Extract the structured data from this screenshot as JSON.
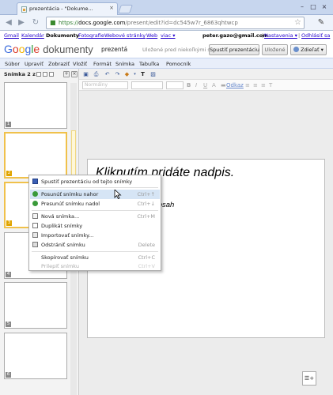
{
  "browser": {
    "tab_title": "prezentácia - \"Dokume...",
    "tab_close": "×",
    "url_scheme": "https://",
    "url_host": "docs.google.com",
    "url_path": "/present/edit?id=dc545w7r_6863qhtwcp"
  },
  "gbar": {
    "links": [
      "Gmail",
      "Kalendár",
      "Dokumenty",
      "Fotografie",
      "Webové stránky",
      "Web",
      "viac ▾"
    ],
    "current": "Dokumenty",
    "user": "peter.gazo@gmail.com",
    "settings": "Nastavenia ▾",
    "signout": "Odhlásiť sa"
  },
  "header": {
    "logo_google": "Google",
    "logo_product": "dokumenty",
    "doc_title": "prezentá",
    "save_status": "Uložené pred niekoľkými sekundami",
    "start_btn": "Spustiť prezentáciu",
    "saved_btn": "Uložené",
    "share_btn": "Zdieľať ▾"
  },
  "menu": [
    "Súbor",
    "Upraviť",
    "Zobraziť",
    "Vložiť",
    "Formát",
    "Snímka",
    "Tabuľka",
    "Pomocník"
  ],
  "leftpanel": {
    "slide_count": "Snímka 2 z 7",
    "thumb_numbers": [
      "1",
      "2",
      "3",
      "4",
      "5",
      "6"
    ]
  },
  "format": {
    "style": "Normálny",
    "link": "Odkaz"
  },
  "slide": {
    "title_placeholder": "Kliknutím pridáte nadpis.",
    "body_placeholder": "bsah"
  },
  "context_menu": {
    "items": [
      {
        "label": "Spustiť prezentáciu od tejto snímky",
        "shortcut": "",
        "disabled": false
      },
      {
        "label": "Posunúť snímku nahor",
        "shortcut": "Ctrl+↑",
        "disabled": false
      },
      {
        "label": "Presunúť snímku nadol",
        "shortcut": "Ctrl+↓",
        "disabled": false
      },
      {
        "label": "Nová snímka...",
        "shortcut": "Ctrl+M",
        "disabled": false
      },
      {
        "label": "Duplikát snímky",
        "shortcut": "",
        "disabled": false
      },
      {
        "label": "Importovať snímky...",
        "shortcut": "",
        "disabled": false
      },
      {
        "label": "Odstrániť snímku",
        "shortcut": "Delete",
        "disabled": false
      },
      {
        "label": "Skopírovať snímku",
        "shortcut": "Ctrl+C",
        "disabled": false
      },
      {
        "label": "Prilepiť snímku",
        "shortcut": "Ctrl+V",
        "disabled": true
      }
    ]
  },
  "colors": {
    "accent": "#3b6bdc",
    "selection": "#f0c14b",
    "menu_bg": "#e8eefa",
    "highlight": "#d6e5f5"
  }
}
